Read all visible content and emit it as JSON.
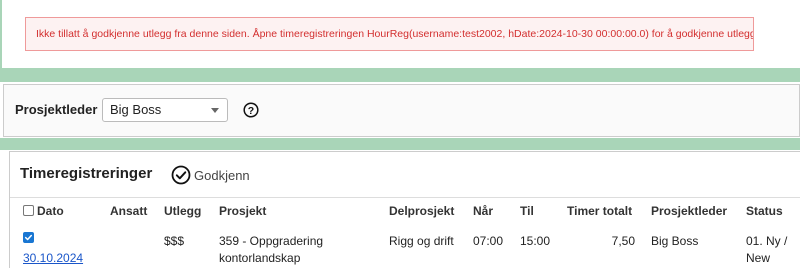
{
  "error": {
    "message": "Ikke tillatt å godkjenne utlegg fra denne siden. Åpne timeregistreringen HourReg(username:test2002, hDate:2024-10-30 00:00:00.0) for å godkjenne utlegget."
  },
  "project_manager_filter": {
    "label": "Prosjektleder",
    "selected": "Big Boss"
  },
  "time_registrations": {
    "title": "Timeregistreringer",
    "approve_label": "Godkjenn",
    "columns": {
      "date": "Dato",
      "employee": "Ansatt",
      "expense": "Utlegg",
      "project": "Prosjekt",
      "subproject": "Delprosjekt",
      "from": "Når",
      "to": "Til",
      "total_hours": "Timer totalt",
      "project_manager": "Prosjektleder",
      "status": "Status"
    },
    "rows": [
      {
        "checked": true,
        "date": "30.10.2024",
        "employee": "",
        "expense": "$$$",
        "project_line1": "359 - Oppgradering",
        "project_line2": "kontorlandskap",
        "subproject": "Rigg og drift",
        "from": "07:00",
        "to": "15:00",
        "total_hours": "7,50",
        "project_manager": "Big Boss",
        "status_line1": "01. Ny /",
        "status_line2": "New"
      }
    ]
  },
  "colors": {
    "band": "#a9d5b8",
    "error_text": "#d32f2f",
    "error_border": "#ef9a9a",
    "link": "#1a56c9",
    "checkbox": "#1976d2"
  }
}
